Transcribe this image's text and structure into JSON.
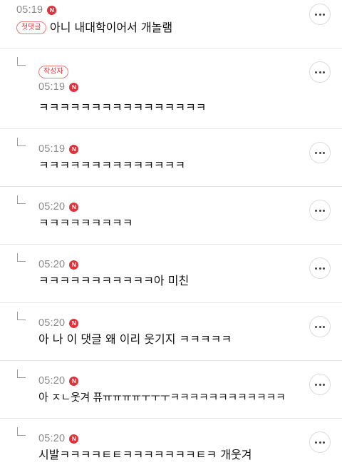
{
  "comments": [
    {
      "time": "05:19",
      "badge": "N",
      "tag": "첫댓글",
      "text": "아니 내대학이어서 개놀램",
      "is_reply": false
    },
    {
      "time": "05:19",
      "badge": "N",
      "tag": "작성자",
      "text": "ㅋㅋㅋㅋㅋㅋㅋㅋㅋㅋㅋㅋㅋㅋㅋㅋ",
      "is_reply": true
    },
    {
      "time": "05:19",
      "badge": "N",
      "text": "ㅋㅋㅋㅋㅋㅋㅋㅋㅋㅋㅋㅋㅋㅋ",
      "is_reply": true
    },
    {
      "time": "05:20",
      "badge": "N",
      "text": "ㅋㅋㅋㅋㅋㅋㅋㅋㅋ",
      "is_reply": true
    },
    {
      "time": "05:20",
      "badge": "N",
      "text": "ㅋㅋㅋㅋㅋㅋㅋㅋㅋㅋㅋ아 미친",
      "is_reply": true
    },
    {
      "time": "05:20",
      "badge": "N",
      "text": "아 나 이 댓글 왜 이리 웃기지 ㅋㅋㅋㅋㅋ",
      "is_reply": true
    },
    {
      "time": "05:20",
      "badge": "N",
      "text": "아 ㅈㄴ웃겨 퓨ㅠㅠㅠㅠㅜㅜㅜㅋㅋㅋㅋㅋㅋㅋㅋㅋㅋㅋㅋ",
      "is_reply": true
    },
    {
      "time": "05:20",
      "badge": "N",
      "text": "시발ㅋㅋㅋㅋㅌㅌㅋㅋㅋㅋㅋㅋㅋㅌㅋ 개웃겨",
      "is_reply": true
    }
  ],
  "icons": {
    "more": "more-horizontal-icon",
    "reply": "reply-arrow-icon",
    "new": "new-badge-icon"
  },
  "colors": {
    "accent": "#e0323a",
    "meta_text": "#8a8a8a",
    "divider": "#e6e6e6"
  }
}
